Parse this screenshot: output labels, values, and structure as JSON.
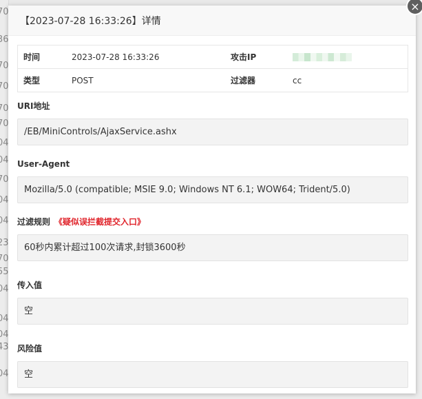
{
  "background_row_digits": [
    "70",
    "36",
    "70",
    "70",
    "70",
    "70",
    "04",
    "04",
    "70",
    "04",
    "04",
    "23",
    "70",
    "55",
    "04",
    "04",
    "04",
    "43",
    "04"
  ],
  "dialog": {
    "title": "【2023-07-28 16:33:26】详情",
    "close_glyph": "×"
  },
  "info": {
    "time_label": "时间",
    "time_value": "2023-07-28 16:33:26",
    "ip_label": "攻击IP",
    "type_label": "类型",
    "type_value": "POST",
    "filter_label": "过滤器",
    "filter_value": "cc"
  },
  "uri": {
    "label": "URI地址",
    "value": "/EB/MiniControls/AjaxService.ashx"
  },
  "user_agent": {
    "label": "User-Agent",
    "value": "Mozilla/5.0 (compatible; MSIE 9.0; Windows NT 6.1; WOW64; Trident/5.0)"
  },
  "rule": {
    "label": "过滤规则",
    "link": "《疑似误拦截提交入口》",
    "value": "60秒内累计超过100次请求,封锁3600秒"
  },
  "input_value": {
    "label": "传入值",
    "value": "空"
  },
  "risk_value": {
    "label": "风险值",
    "value": "空"
  },
  "colors": {
    "accent_red": "#e0242b",
    "close_button": "#5f5f5f",
    "box_background": "#f3f3f3"
  }
}
